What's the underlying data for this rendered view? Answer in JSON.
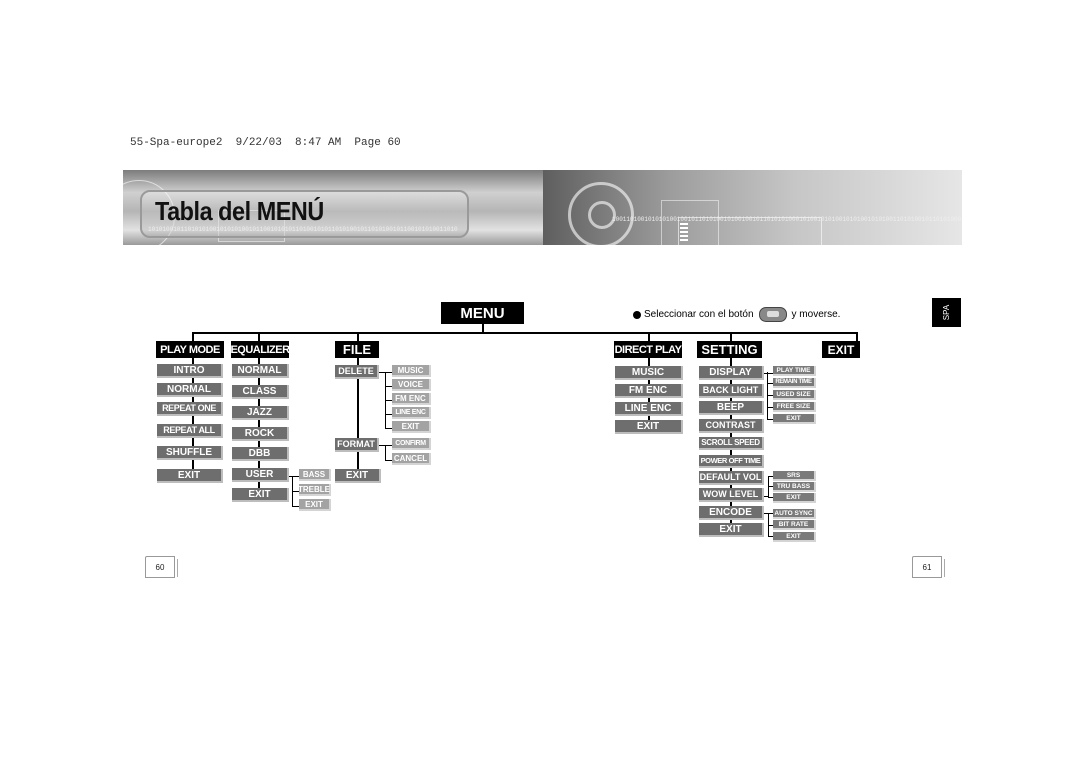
{
  "header": {
    "print_info": "55-Spa-europe2  9/22/03  8:47 AM  Page 60"
  },
  "banner": {
    "title": "Tabla del MENÚ",
    "binary_left": "10101001011010101001010101001011001010101101001010110101001011010100101100101010011010010101101001010110101001",
    "binary_right": "1001101001010101001001011010100101001001011010101000101001010100101010010101001101010010110101000101001010101001"
  },
  "side_tab": "SPA",
  "note": {
    "prefix": "Seleccionar con el botón",
    "suffix": "y moverse.",
    "icon": "jog-button-icon"
  },
  "menu": {
    "root": "MENU",
    "play_mode": {
      "label": "PLAY MODE",
      "items": [
        "INTRO",
        "NORMAL",
        "REPEAT ONE",
        "REPEAT ALL",
        "SHUFFLE",
        "EXIT"
      ]
    },
    "equalizer": {
      "label": "EQUALIZER",
      "items": [
        "NORMAL",
        "CLASS",
        "JAZZ",
        "ROCK",
        "DBB",
        "USER",
        "EXIT"
      ],
      "user_sub": [
        "BASS",
        "TREBLE",
        "EXIT"
      ]
    },
    "file": {
      "label": "FILE",
      "items": [
        "DELETE",
        "FORMAT",
        "EXIT"
      ],
      "delete_sub": [
        "MUSIC",
        "VOICE",
        "FM ENC",
        "LINE ENC",
        "EXIT"
      ],
      "format_sub": [
        "CONFIRM",
        "CANCEL"
      ]
    },
    "direct_play": {
      "label": "DIRECT PLAY",
      "items": [
        "MUSIC",
        "FM ENC",
        "LINE ENC",
        "EXIT"
      ]
    },
    "setting": {
      "label": "SETTING",
      "items": [
        "DISPLAY",
        "BACK LIGHT",
        "BEEP",
        "CONTRAST",
        "SCROLL SPEED",
        "POWER OFF TIME",
        "DEFAULT VOL",
        "WOW LEVEL",
        "ENCODE",
        "EXIT"
      ],
      "display_sub": [
        "PLAY TIME",
        "REMAIN TIME",
        "USED SIZE",
        "FREE SIZE",
        "EXIT"
      ],
      "wow_sub": [
        "SRS",
        "TRU BASS",
        "EXIT"
      ],
      "encode_sub": [
        "AUTO SYNC",
        "BIT RATE",
        "EXIT"
      ]
    },
    "exit": {
      "label": "EXIT"
    }
  },
  "pages": {
    "left": "60",
    "right": "61"
  }
}
